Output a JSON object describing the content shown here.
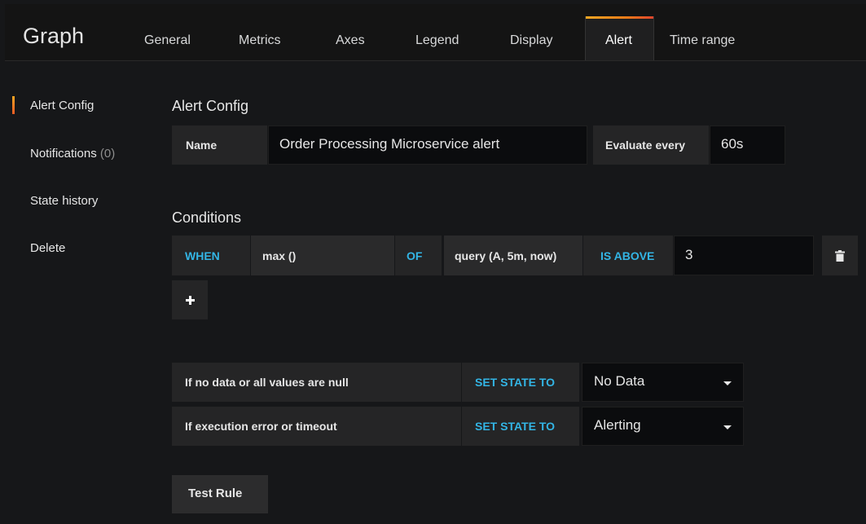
{
  "header": {
    "title": "Graph",
    "tabs": [
      {
        "label": "General"
      },
      {
        "label": "Metrics"
      },
      {
        "label": "Axes"
      },
      {
        "label": "Legend"
      },
      {
        "label": "Display"
      },
      {
        "label": "Alert",
        "active": true
      },
      {
        "label": "Time range"
      }
    ]
  },
  "sidebar": {
    "items": [
      {
        "label": "Alert Config",
        "active": true
      },
      {
        "label": "Notifications",
        "count": "(0)"
      },
      {
        "label": "State history"
      },
      {
        "label": "Delete"
      }
    ]
  },
  "alert_config": {
    "title": "Alert Config",
    "name_label": "Name",
    "name_value": "Order Processing Microservice alert",
    "evaluate_label": "Evaluate every",
    "evaluate_value": "60s"
  },
  "conditions": {
    "title": "Conditions",
    "when_label": "WHEN",
    "reducer": "max ()",
    "of_label": "OF",
    "query": "query (A, 5m, now)",
    "evaluator": "IS ABOVE",
    "threshold": "3",
    "add_icon": "plus-icon",
    "delete_icon": "trash-icon"
  },
  "state_rules": [
    {
      "condition": "If no data or all values are null",
      "action": "SET STATE TO",
      "value": "No Data"
    },
    {
      "condition": "If execution error or timeout",
      "action": "SET STATE TO",
      "value": "Alerting"
    }
  ],
  "test_rule_label": "Test Rule",
  "colors": {
    "accent_blue": "#33b5e5",
    "active_tab_border": "#eb7b18",
    "background": "#161719"
  }
}
